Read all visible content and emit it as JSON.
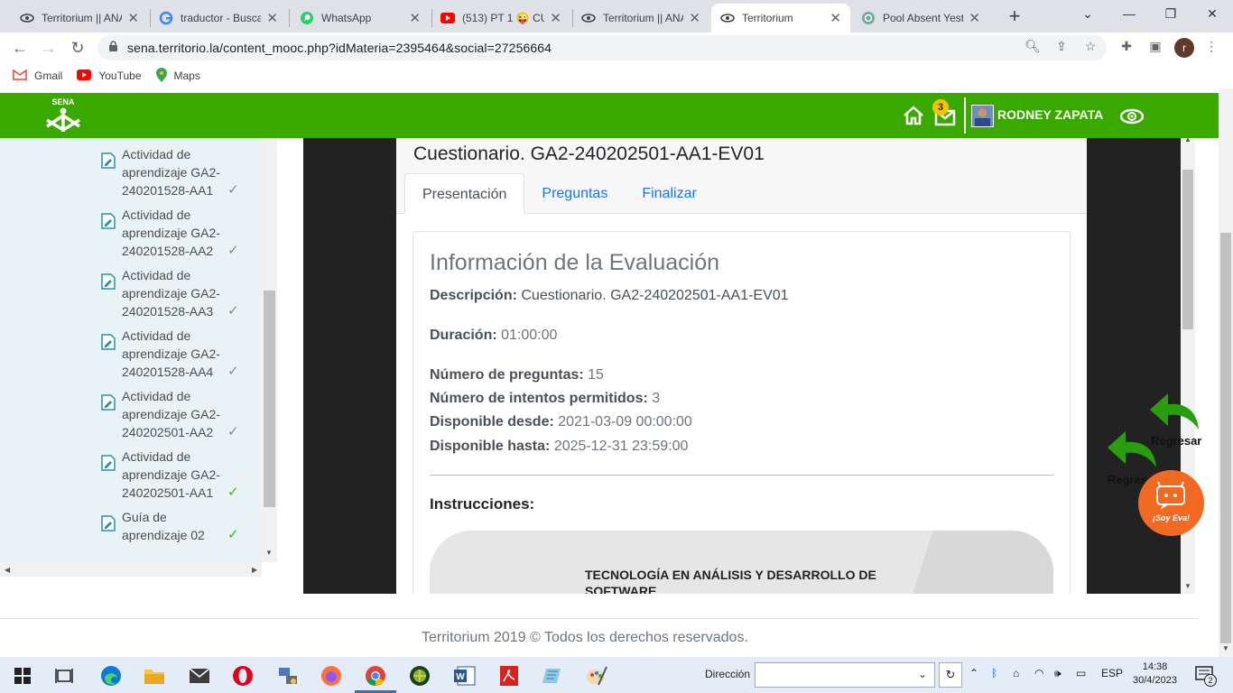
{
  "browser": {
    "tabs": [
      {
        "title": "Territorium || ANA",
        "icon": "eye-icon"
      },
      {
        "title": "traductor - Busca",
        "icon": "google-icon"
      },
      {
        "title": "WhatsApp",
        "icon": "whatsapp-icon"
      },
      {
        "title": "(513) PT 1 😜 CU",
        "icon": "youtube-icon"
      },
      {
        "title": "Territorium || ANA",
        "icon": "eye-icon"
      },
      {
        "title": "Territorium",
        "icon": "eye-icon",
        "active": true
      },
      {
        "title": "Pool Absent Yeste",
        "icon": "openai-icon"
      }
    ],
    "new_tab": "+",
    "url": "sena.territorio.la/content_mooc.php?idMateria=2395464&social=27256664",
    "profile_initial": "r",
    "bookmarks": [
      {
        "label": "Gmail",
        "icon": "gmail-icon"
      },
      {
        "label": "YouTube",
        "icon": "youtube-icon"
      },
      {
        "label": "Maps",
        "icon": "maps-icon"
      }
    ]
  },
  "site": {
    "logo_text": "SENA",
    "brand_color": "#39a900",
    "notifications": "3",
    "user_name": "RODNEY ZAPATA"
  },
  "sidebar": {
    "items": [
      {
        "text": "Actividad de aprendizaje GA2-240201528-AA1",
        "check_color": "#888888"
      },
      {
        "text": "Actividad de aprendizaje GA2-240201528-AA2",
        "check_color": "#888888"
      },
      {
        "text": "Actividad de aprendizaje GA2-240201528-AA3",
        "check_color": "#888888"
      },
      {
        "text": "Actividad de aprendizaje GA2-240201528-AA4",
        "check_color": "#888888"
      },
      {
        "text": "Actividad de aprendizaje GA2-240202501-AA2",
        "check_color": "#888888"
      },
      {
        "text": "Actividad de aprendizaje GA2-240202501-AA1",
        "check_color": "#39c000"
      },
      {
        "text": "Guía de aprendizaje 02",
        "check_color": "#39c000"
      }
    ]
  },
  "modal": {
    "title": "Cuestionario. GA2-240202501-AA1-EV01",
    "tabs": [
      "Presentación",
      "Preguntas",
      "Finalizar"
    ],
    "card_heading": "Información de la Evaluación",
    "fields": {
      "descripcion_label": "Descripción:",
      "descripcion_value": "Cuestionario. GA2-240202501-AA1-EV01",
      "duracion_label": "Duración:",
      "duracion_value": "01:00:00",
      "preguntas_label": "Número de preguntas:",
      "preguntas_value": "15",
      "intentos_label": "Número de intentos permitidos:",
      "intentos_value": "3",
      "desde_label": "Disponible desde:",
      "desde_value": "2021-03-09 00:00:00",
      "hasta_label": "Disponible hasta:",
      "hasta_value": "2025-12-31 23:59:00"
    },
    "instructions_label": "Instrucciones:",
    "banner_text": "TECNOLOGÍA EN ANÁLISIS Y DESARROLLO DE SOFTWARE"
  },
  "floating": {
    "regresar_1": "Regresar",
    "regresar_2": "Regres",
    "eva_label": "¡Soy Eva!"
  },
  "footer": {
    "text": "Territorium 2019 © Todos los derechos reservados."
  },
  "taskbar": {
    "direccion_label": "Dirección",
    "language": "ESP",
    "time": "14:38",
    "date": "30/4/2023",
    "notification_count": "2"
  }
}
